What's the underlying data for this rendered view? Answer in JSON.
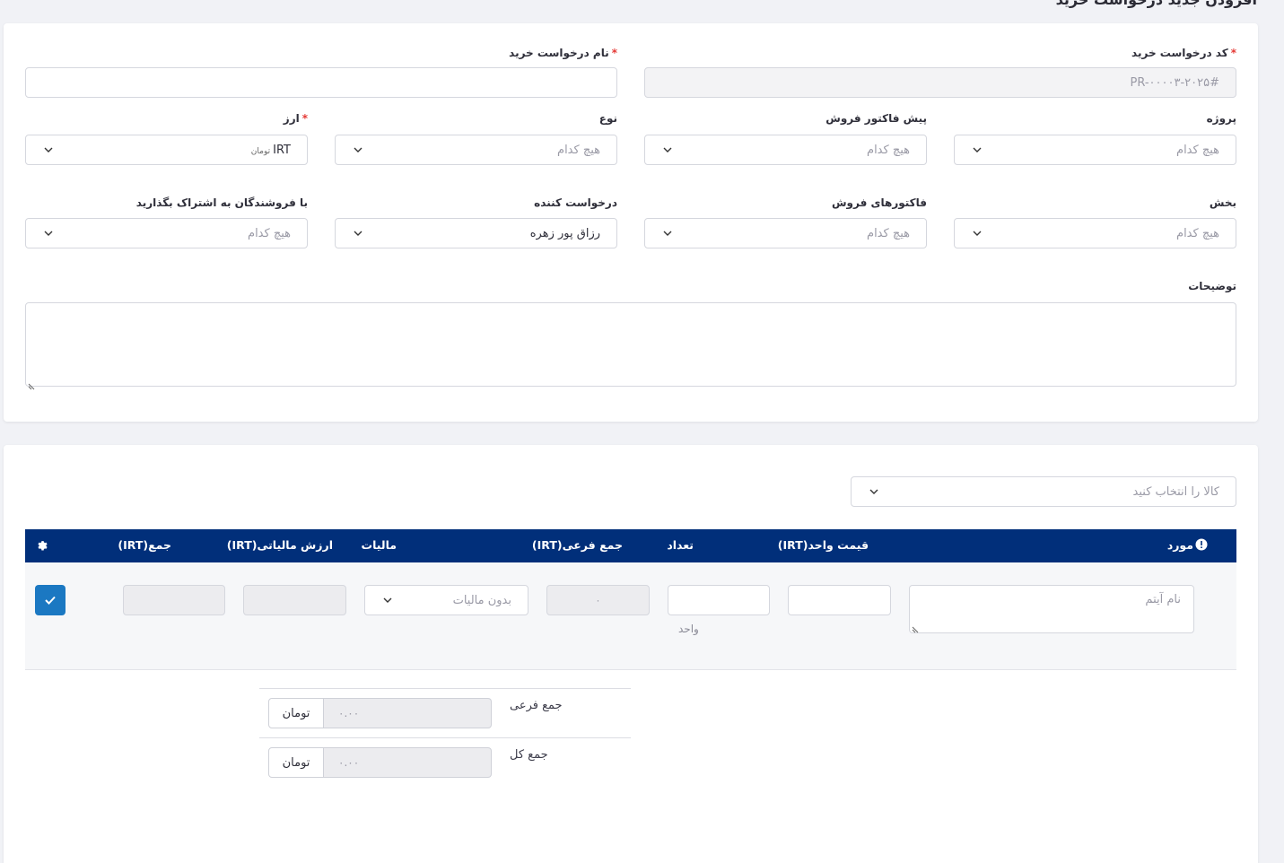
{
  "page": {
    "title": "افزودن جدید درخواست خرید"
  },
  "form": {
    "code": {
      "label": "کد درخواست خرید",
      "value": "#PR-۰۰۰۰۳-۲۰۲۵"
    },
    "name": {
      "label": "نام درخواست خرید",
      "value": ""
    },
    "project": {
      "label": "پروژه",
      "value": "هیچ کدام"
    },
    "proforma": {
      "label": "پیش فاکتور فروش",
      "value": "هیچ کدام"
    },
    "type": {
      "label": "نوع",
      "value": "هیچ کدام"
    },
    "currency": {
      "label": "ارز",
      "value": "IRT",
      "sub": "تومان"
    },
    "department": {
      "label": "بخش",
      "value": "هیچ کدام"
    },
    "invoices": {
      "label": "فاکتورهای فروش",
      "value": "هیچ کدام"
    },
    "requester": {
      "label": "درخواست کننده",
      "value": "رزاق پور زهره"
    },
    "share_vendors": {
      "label": "با فروشندگان به اشتراک بگذارید",
      "value": "هیچ کدام"
    },
    "notes": {
      "label": "توضیحات",
      "value": ""
    },
    "required_mark": "*"
  },
  "items": {
    "select_placeholder": "کالا را انتخاب کنید",
    "columns": {
      "item": "مورد",
      "unit_price": "قیمت واحد(IRT)",
      "qty": "تعداد",
      "subtotal": "جمع فرعی(IRT)",
      "tax": "مالیات",
      "tax_value": "ارزش مالیاتی(IRT)",
      "total": "جمع(IRT)"
    },
    "row": {
      "item_placeholder": "نام آیتم",
      "unit_label": "واحد",
      "subtotal": "۰",
      "tax_placeholder": "بدون مالیات"
    }
  },
  "totals": {
    "subtotal_label": "جمع فرعی",
    "subtotal_value": "۰.۰۰",
    "total_label": "جمع کل",
    "total_value": "۰.۰۰",
    "currency": "تومان"
  },
  "colors": {
    "header": "#012f7a",
    "accent": "#1b78c2",
    "required": "#e53935"
  }
}
